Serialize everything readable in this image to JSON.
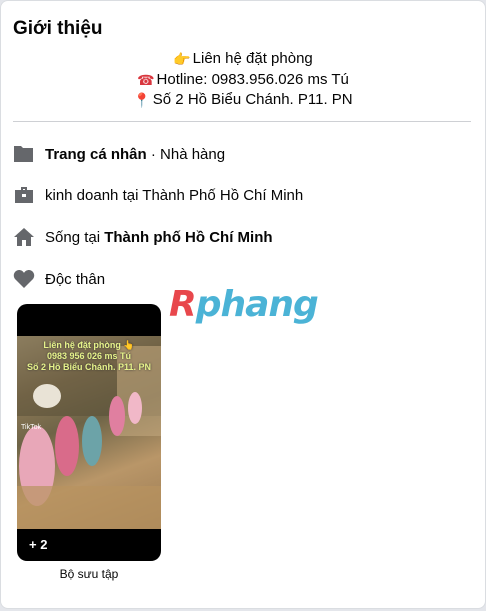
{
  "intro": {
    "title": "Giới thiệu",
    "bio": [
      {
        "icon": "pointing-hand-icon",
        "glyph": "👉",
        "text": "Liên hệ đặt phòng"
      },
      {
        "icon": "telephone-icon",
        "glyph": "☎",
        "text": "Hotline: 0983.956.026 ms Tú"
      },
      {
        "icon": "location-pin-icon",
        "glyph": "📍",
        "text": "Số 2 Hồ Biểu Chánh. P11. PN"
      }
    ]
  },
  "details": {
    "page_type": {
      "bold": "Trang cá nhân",
      "rest": " · Nhà hàng"
    },
    "work": {
      "text": "kinh doanh tại Thành Phố Hồ Chí Minh"
    },
    "lives": {
      "prefix": "Sống tại ",
      "bold": "Thành phố Hồ Chí Minh"
    },
    "relationship": {
      "text": "Độc thân"
    }
  },
  "watermark": {
    "part1": "R",
    "part2": "phang"
  },
  "featured": {
    "overlay_lines": [
      "Liên hệ đặt phòng 👆",
      "0983 956 026 ms Tú",
      "Số 2 Hồ Biểu Chánh. P11. PN"
    ],
    "tiktok_label": "TikTok",
    "count": "+ 2",
    "caption": "Bộ sưu tập"
  },
  "colors": {
    "icon_gray": "#65676b",
    "card_bg": "#ffffff",
    "page_bg": "#e4e6eb"
  }
}
